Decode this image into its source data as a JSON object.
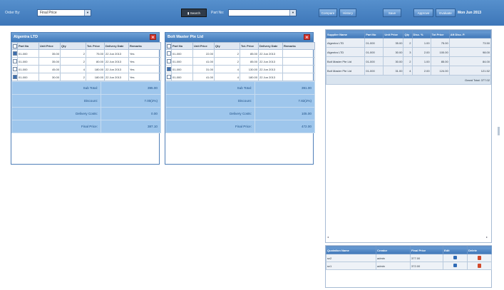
{
  "toolbar": {
    "order_by_label": "Order By:",
    "order_by_value": "Final Price",
    "search_label": "Search",
    "part_no_label": "Part No:",
    "part_no_value": "",
    "btn_compare": "Compare",
    "btn_history": "History",
    "btn_save": "Save",
    "btn_approve": "Approve",
    "btn_evaluate": "Evaluate",
    "date": "Mon Jun 2013"
  },
  "suppliers": [
    {
      "name": "Algentra LTD",
      "columns": [
        "",
        "Part No",
        "Unit Price",
        "Qty",
        "Tot. Price",
        "Delivery Date",
        "Remarks"
      ],
      "rows": [
        {
          "checked": true,
          "part": "01-000",
          "unit": "35.00",
          "qty": "2",
          "tot": "75.00",
          "date": "22 Jun 2013",
          "remarks": "Yes"
        },
        {
          "checked": false,
          "part": "01-000",
          "unit": "35.00",
          "qty": "2",
          "tot": "80.00",
          "date": "22 Jun 2013",
          "remarks": "Yes"
        },
        {
          "checked": false,
          "part": "01-000",
          "unit": "45.00",
          "qty": "4",
          "tot": "180.00",
          "date": "22 Jun 2013",
          "remarks": "Yes"
        },
        {
          "checked": true,
          "part": "01-000",
          "unit": "30.00",
          "qty": "2",
          "tot": "180.00",
          "date": "22 Jun 2013",
          "remarks": "Yes"
        }
      ],
      "sub_total_label": "Sub Total:",
      "sub_total": "395.00",
      "discount_label": "Discount:",
      "discount": "7.00(2%)",
      "delivery_label": "Delivery Costs:",
      "delivery": "0.00",
      "final_label": "Final Price:",
      "final": "387.10"
    },
    {
      "name": "Bolt Master Pte Ltd",
      "columns": [
        "",
        "Part No",
        "Unit Price",
        "Qty",
        "Tot. Price",
        "Delivery Date",
        "Remarks"
      ],
      "rows": [
        {
          "checked": false,
          "part": "01-000",
          "unit": "22.00",
          "qty": "2",
          "tot": "85.00",
          "date": "22 Jun 2013",
          "remarks": ""
        },
        {
          "checked": false,
          "part": "01-000",
          "unit": "41.00",
          "qty": "2",
          "tot": "85.00",
          "date": "22 Jun 2013",
          "remarks": ""
        },
        {
          "checked": true,
          "part": "01-000",
          "unit": "31.00",
          "qty": "4",
          "tot": "130.00",
          "date": "22 Jun 2013",
          "remarks": ""
        },
        {
          "checked": false,
          "part": "01-000",
          "unit": "41.00",
          "qty": "4",
          "tot": "180.00",
          "date": "22 Jun 2013",
          "remarks": ""
        }
      ],
      "sub_total_label": "Sub Total:",
      "sub_total": "391.00",
      "discount_label": "Discount:",
      "discount": "7.82(2%)",
      "delivery_label": "Delivery Costs:",
      "delivery": "105.00",
      "final_label": "Final Price:",
      "final": "472.00"
    }
  ],
  "selected": {
    "columns": [
      "Supplier Name",
      "Part No",
      "Unit Price",
      "Qty",
      "Disc. %",
      "Tot Price",
      "Aft Disc. P."
    ],
    "rows": [
      {
        "supplier": "Algentra LTD",
        "part": "01-000",
        "unit": "35.00",
        "qty": "2",
        "disc": "1.00",
        "tot": "75.00",
        "aft": "73.50"
      },
      {
        "supplier": "Algentra LTD",
        "part": "01-000",
        "unit": "30.00",
        "qty": "3",
        "disc": "2.00",
        "tot": "100.00",
        "aft": "98.00"
      },
      {
        "supplier": "Bolt Master Pte Ltd",
        "part": "01-000",
        "unit": "30.00",
        "qty": "2",
        "disc": "1.00",
        "tot": "85.00",
        "aft": "84.00"
      },
      {
        "supplier": "Bolt Master Pte Ltd",
        "part": "01-000",
        "unit": "31.00",
        "qty": "4",
        "disc": "2.00",
        "tot": "124.00",
        "aft": "121.52"
      }
    ],
    "grand_total": "Grand Total: 377.02"
  },
  "saved": {
    "columns": [
      "Quotation Name",
      "Creator",
      "Final Price",
      "Edit",
      "Delete"
    ],
    "rows": [
      {
        "name": "sv2",
        "creator": "admin",
        "price": "377.00"
      },
      {
        "name": "sv1",
        "creator": "admin",
        "price": "372.00"
      }
    ]
  },
  "colors": {
    "accent": "#3d76b8",
    "summary": "#9ec6ec",
    "close": "#d63b34"
  }
}
